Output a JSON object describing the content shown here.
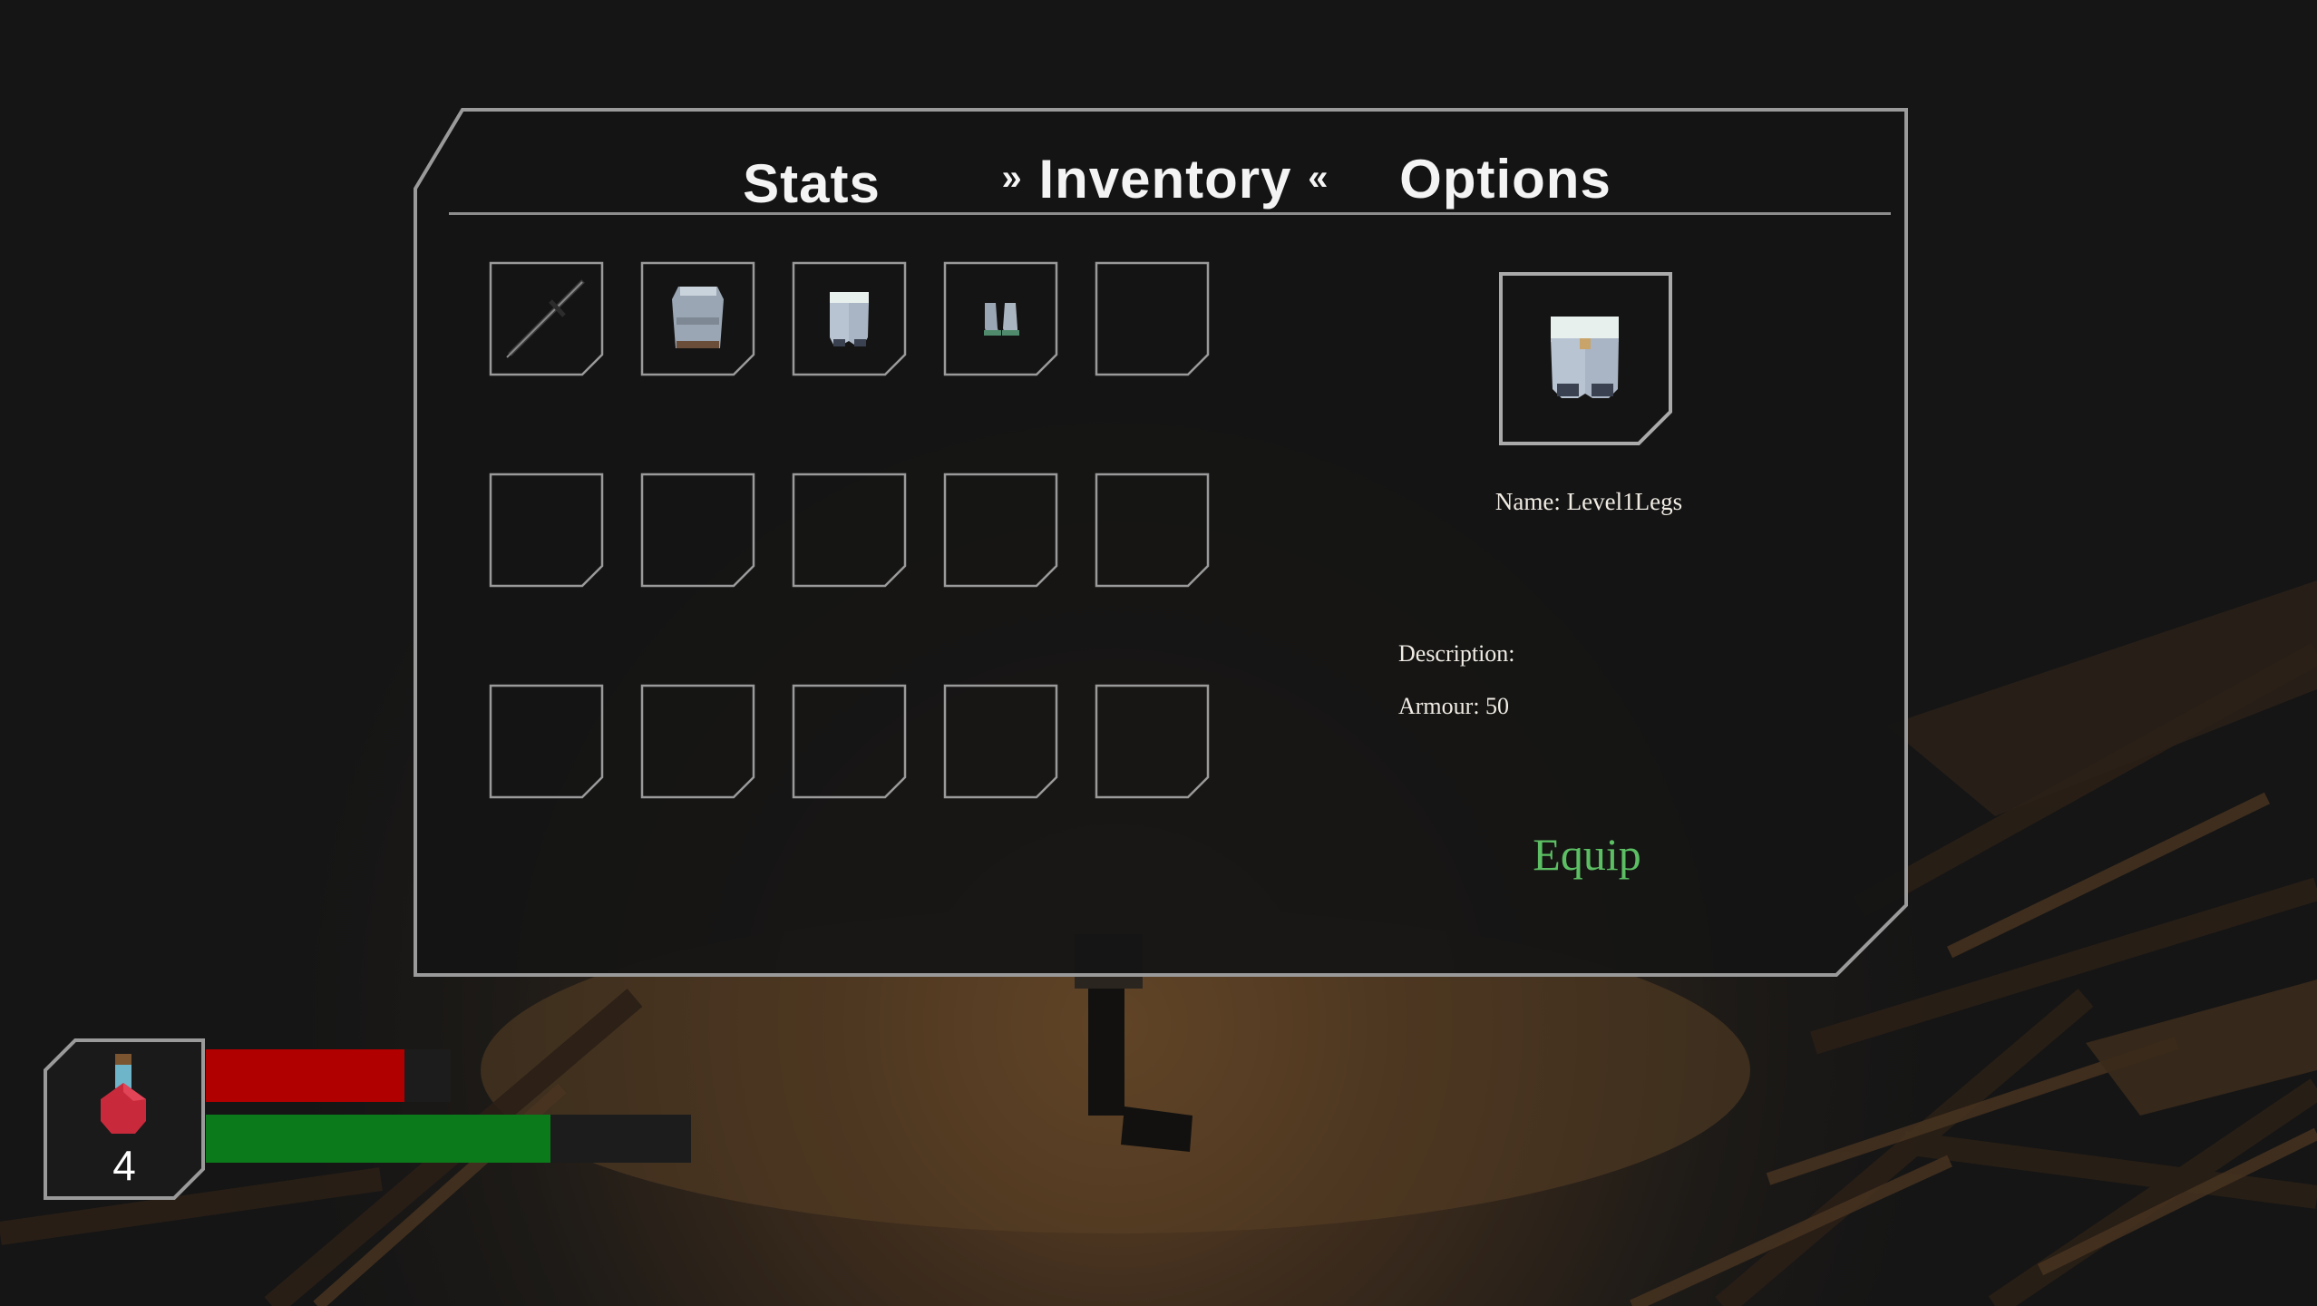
{
  "tabs": {
    "stats": "Stats",
    "inventory": "Inventory",
    "options": "Options",
    "active_left_marker": "»",
    "active_right_marker": "«"
  },
  "inventory": {
    "slots": [
      {
        "item": "sword"
      },
      {
        "item": "chest-armour"
      },
      {
        "item": "leg-armour"
      },
      {
        "item": "boots"
      },
      {
        "item": ""
      },
      {
        "item": ""
      },
      {
        "item": ""
      },
      {
        "item": ""
      },
      {
        "item": ""
      },
      {
        "item": ""
      },
      {
        "item": ""
      },
      {
        "item": ""
      },
      {
        "item": ""
      },
      {
        "item": ""
      },
      {
        "item": ""
      }
    ]
  },
  "selected_item": {
    "icon": "leg-armour",
    "name_text": "Name: Level1Legs",
    "description_label": "Description:",
    "armour_text": "Armour: 50",
    "equip_label": "Equip"
  },
  "hud": {
    "potion_icon": "health-potion",
    "potion_count": "4",
    "health_fraction": 0.81,
    "stamina_fraction": 0.71,
    "health_color": "#b00000",
    "stamina_color": "#0b7a1a"
  },
  "colors": {
    "panel_bg": "#141414",
    "frame": "#9a9a9a",
    "equip_text": "#5cbf63"
  }
}
